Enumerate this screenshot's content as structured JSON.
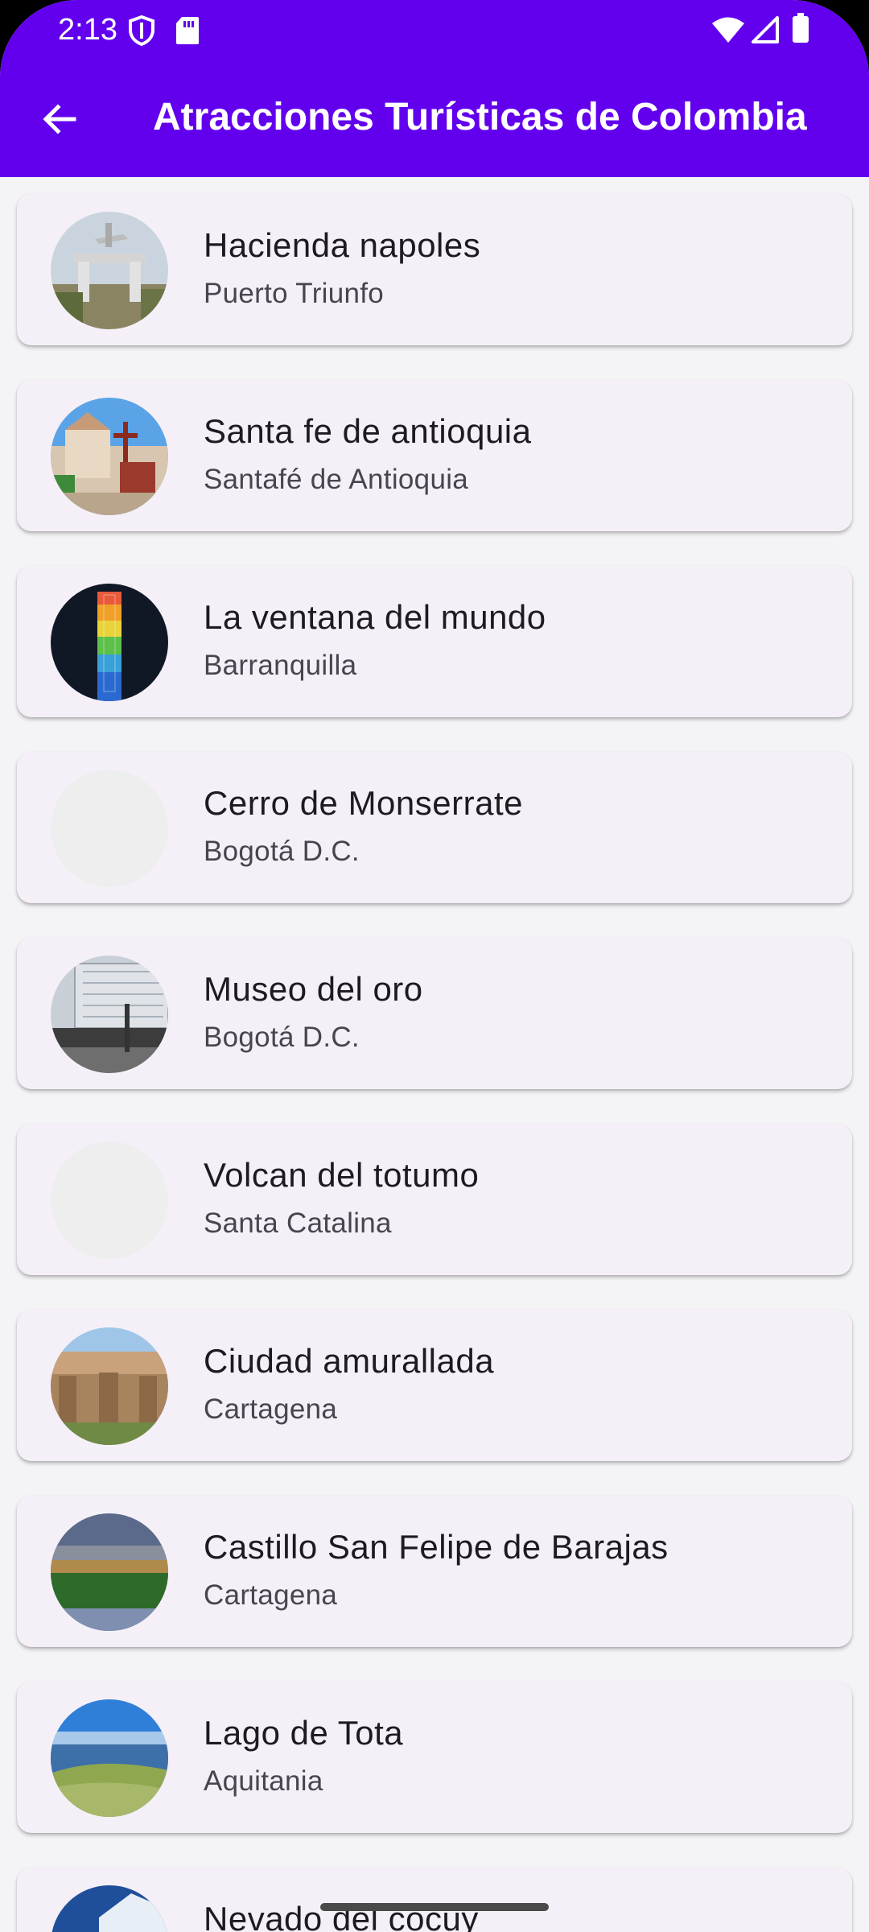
{
  "status_bar": {
    "time": "2:13",
    "icons": [
      "shield-icon",
      "sd-card-icon",
      "wifi-icon",
      "signal-icon",
      "battery-icon"
    ]
  },
  "app_bar": {
    "title": "Atracciones Turísticas de Colombia",
    "back_icon": "arrow-back-icon",
    "background_color": "#6200ee"
  },
  "places": [
    {
      "name": "Hacienda napoles",
      "location": "Puerto Triunfo",
      "image": "photo"
    },
    {
      "name": "Santa fe de antioquia",
      "location": "Santafé de Antioquia",
      "image": "photo"
    },
    {
      "name": "La ventana del mundo",
      "location": "Barranquilla",
      "image": "photo"
    },
    {
      "name": "Cerro de Monserrate",
      "location": "Bogotá D.C.",
      "image": "placeholder"
    },
    {
      "name": "Museo del oro",
      "location": "Bogotá D.C.",
      "image": "photo"
    },
    {
      "name": "Volcan del totumo",
      "location": "Santa Catalina",
      "image": "placeholder"
    },
    {
      "name": "Ciudad amurallada",
      "location": "Cartagena",
      "image": "photo"
    },
    {
      "name": "Castillo San Felipe de Barajas",
      "location": "Cartagena",
      "image": "photo"
    },
    {
      "name": "Lago de Tota",
      "location": "Aquitania",
      "image": "photo"
    },
    {
      "name": "Nevado del cocuy",
      "location": "",
      "image": "photo"
    }
  ]
}
